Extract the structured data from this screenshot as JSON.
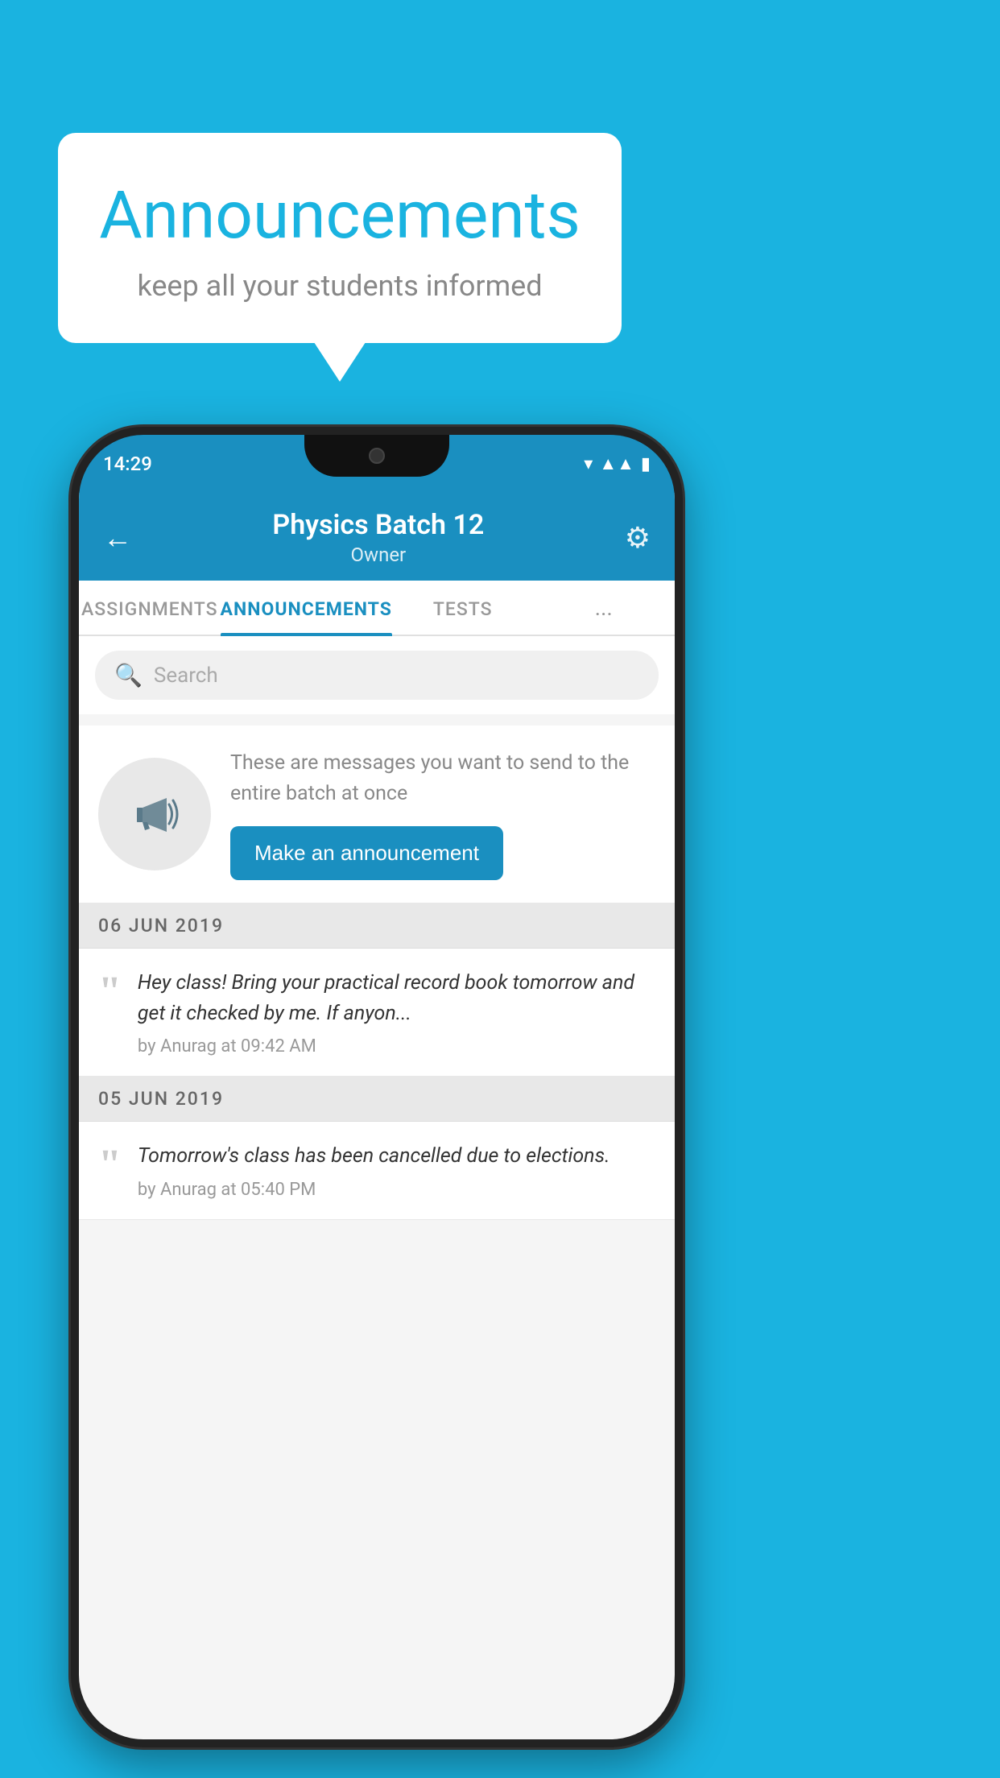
{
  "page": {
    "background_color": "#1ab3e0"
  },
  "speech_bubble": {
    "title": "Announcements",
    "subtitle": "keep all your students informed"
  },
  "phone": {
    "status_bar": {
      "time": "14:29"
    },
    "header": {
      "title": "Physics Batch 12",
      "subtitle": "Owner",
      "back_label": "←",
      "gear_label": "⚙"
    },
    "tabs": [
      {
        "label": "ASSIGNMENTS",
        "active": false
      },
      {
        "label": "ANNOUNCEMENTS",
        "active": true
      },
      {
        "label": "TESTS",
        "active": false
      },
      {
        "label": "...",
        "active": false
      }
    ],
    "search": {
      "placeholder": "Search"
    },
    "announcement_prompt": {
      "message": "These are messages you want to send to the entire batch at once",
      "button_label": "Make an announcement"
    },
    "announcements": [
      {
        "date": "06  JUN  2019",
        "body": "Hey class! Bring your practical record book tomorrow and get it checked by me. If anyon...",
        "meta": "by Anurag at 09:42 AM"
      },
      {
        "date": "05  JUN  2019",
        "body": "Tomorrow's class has been cancelled due to elections.",
        "meta": "by Anurag at 05:40 PM"
      }
    ]
  }
}
